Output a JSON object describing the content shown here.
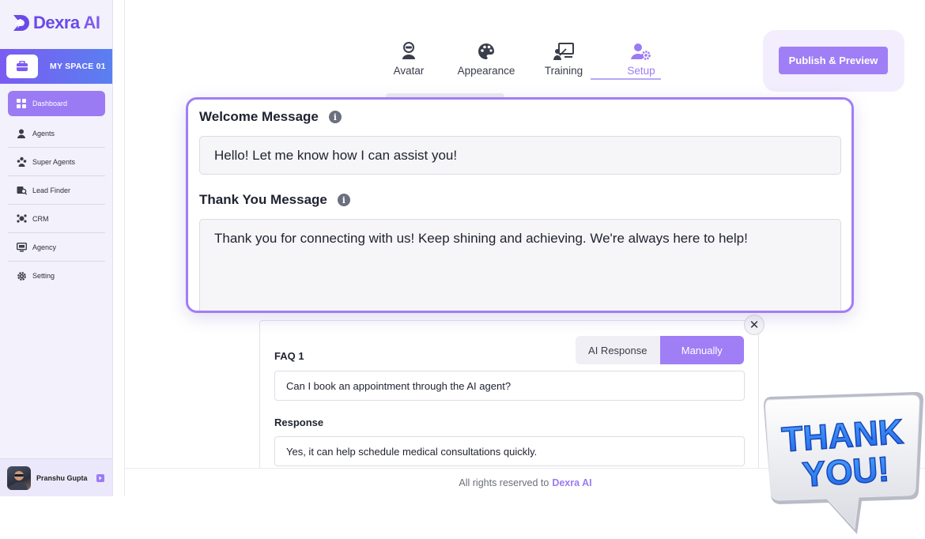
{
  "brand": {
    "name": "Dexra",
    "ai": "AI"
  },
  "workspace": {
    "label": "MY SPACE 01"
  },
  "sidebar": {
    "items": [
      {
        "label": "Dashboard",
        "icon": "grid-icon"
      },
      {
        "label": "Agents",
        "icon": "agent-icon"
      },
      {
        "label": "Super Agents",
        "icon": "super-agents-icon"
      },
      {
        "label": "Lead Finder",
        "icon": "lead-finder-icon"
      },
      {
        "label": "CRM",
        "icon": "crm-icon"
      },
      {
        "label": "Agency",
        "icon": "agency-icon"
      },
      {
        "label": "Setting",
        "icon": "gear-icon"
      }
    ]
  },
  "user": {
    "name": "Pranshu Gupta"
  },
  "tabs": [
    {
      "label": "Avatar",
      "icon": "avatar-icon"
    },
    {
      "label": "Appearance",
      "icon": "palette-icon"
    },
    {
      "label": "Training",
      "icon": "training-icon"
    },
    {
      "label": "Setup",
      "icon": "user-gear-icon"
    }
  ],
  "publish": {
    "label": "Publish & Preview"
  },
  "messages": {
    "welcome_label": "Welcome Message",
    "welcome_value": "Hello! Let me know how I can assist you!",
    "thanks_label": "Thank You Message",
    "thanks_value": "Thank you for connecting with us! Keep shining and achieving. We're always here to help!"
  },
  "faq": {
    "toggle_ai": "AI Response",
    "toggle_manual": "Manually",
    "question_label": "FAQ 1",
    "question_value": "Can I book an appointment through the AI agent?",
    "response_label": "Response",
    "response_value": "Yes, it can help schedule medical consultations quickly."
  },
  "footer": {
    "text": "All rights reserved to",
    "brand": "Dexra AI"
  },
  "badge": {
    "line1": "THANK",
    "line2": "YOU!"
  },
  "colors": {
    "accent": "#a07ef5",
    "brand": "#6a4ae8",
    "badge_blue": "#2f7cf0"
  }
}
